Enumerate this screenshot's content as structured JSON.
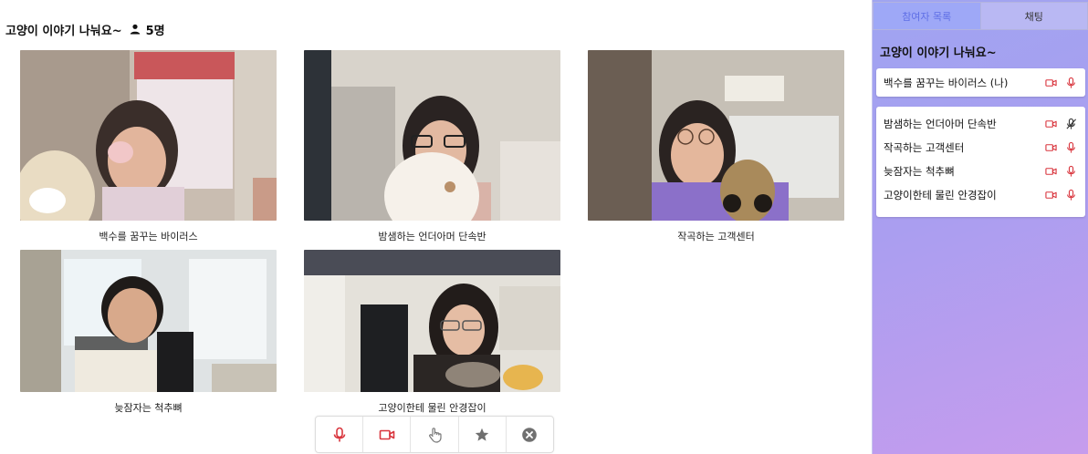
{
  "room": {
    "title": "고양이 이야기 나눠요~",
    "participant_count": "5명"
  },
  "tiles": [
    {
      "name": "백수를 꿈꾸는 바이러스"
    },
    {
      "name": "밤샘하는 언더아머 단속반"
    },
    {
      "name": "작곡하는 고객센터"
    },
    {
      "name": "늦잠자는 척추뼈"
    },
    {
      "name": "고양이한테 물린 안경잡이"
    }
  ],
  "controls": [
    "mic-icon",
    "camera-icon",
    "hand-icon",
    "star-icon",
    "close-circle-icon"
  ],
  "sidebar": {
    "tabs": [
      {
        "label": "참여자 목록",
        "active": true
      },
      {
        "label": "채팅",
        "active": false
      }
    ],
    "title": "고양이 이야기 나눠요~",
    "me": {
      "name": "백수를 꿈꾸는 바이러스 (나)",
      "mic": "on"
    },
    "others": [
      {
        "name": "밤샘하는 언더아머 단속반",
        "mic": "off"
      },
      {
        "name": "작곡하는 고객센터",
        "mic": "on"
      },
      {
        "name": "늦잠자는 척추뼈",
        "mic": "on"
      },
      {
        "name": "고양이한테 물린 안경잡이",
        "mic": "on"
      }
    ]
  },
  "colors": {
    "accent_red": "#d9363e",
    "sidebar_gradient_start": "#9fa4f1",
    "sidebar_gradient_end": "#c69ced",
    "active_tab_text": "#5f6fe6"
  }
}
